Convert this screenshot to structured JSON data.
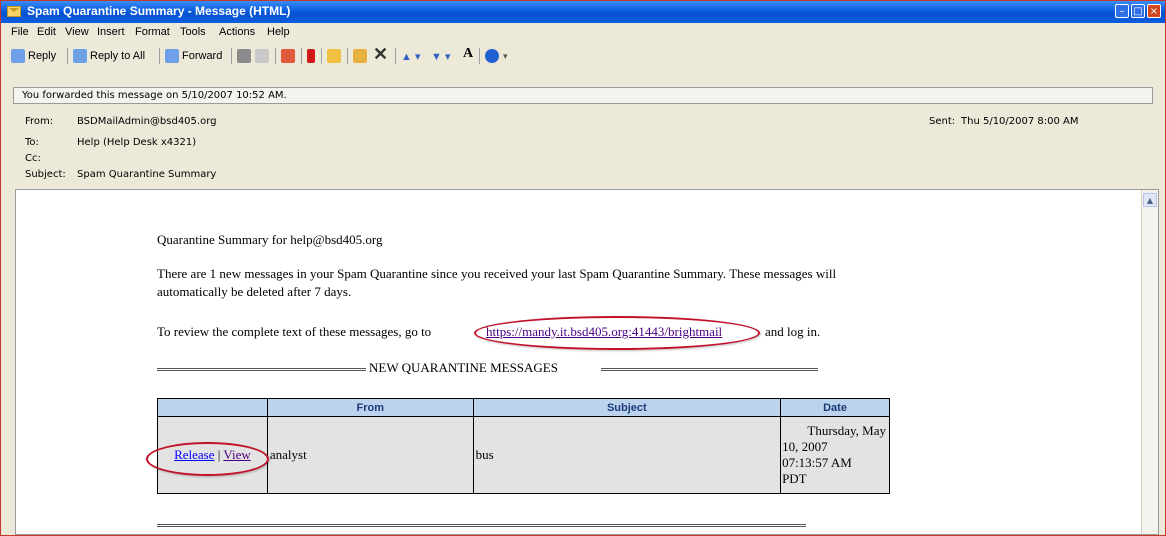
{
  "window": {
    "title": "Spam Quarantine Summary - Message (HTML)"
  },
  "menu": [
    "File",
    "Edit",
    "View",
    "Insert",
    "Format",
    "Tools",
    "Actions",
    "Help"
  ],
  "toolbar": {
    "reply": "Reply",
    "reply_all": "Reply to All",
    "forward": "Forward"
  },
  "notice": "You forwarded this message on 5/10/2007 10:52 AM.",
  "header": {
    "from_label": "From:",
    "from": "BSDMailAdmin@bsd405.org",
    "to_label": "To:",
    "to": "Help (Help Desk x4321)",
    "cc_label": "Cc:",
    "cc": "",
    "subject_label": "Subject:",
    "subject": "Spam Quarantine Summary",
    "sent_label": "Sent:",
    "sent": "Thu 5/10/2007 8:00 AM"
  },
  "body": {
    "summary_line": "Quarantine Summary for help@bsd405.org",
    "para1_line1": "There are 1 new messages in your Spam Quarantine since you received your last Spam Quarantine Summary. These messages will",
    "para1_line2": "automatically be deleted after 7 days.",
    "review_prefix": "To review the complete text of these messages, go to",
    "review_link": "https://mandy.it.bsd405.org:41443/brightmail",
    "review_suffix": "and log in.",
    "section_title": "NEW QUARANTINE MESSAGES"
  },
  "table": {
    "headers": [
      "",
      "From",
      "Subject",
      "Date"
    ],
    "row": {
      "release": "Release",
      "sep": "|",
      "view": "View",
      "from": "analyst",
      "subject": "bus",
      "date_l1": "Thursday, May",
      "date_l2": "10, 2007",
      "date_l3": "07:13:57 AM",
      "date_l4": "PDT"
    }
  },
  "colors": {
    "title_bar": "#0a5ee0",
    "annotation": "#c0102a",
    "table_header": "#bcd3ee",
    "table_cell": "#e3e3e3"
  }
}
